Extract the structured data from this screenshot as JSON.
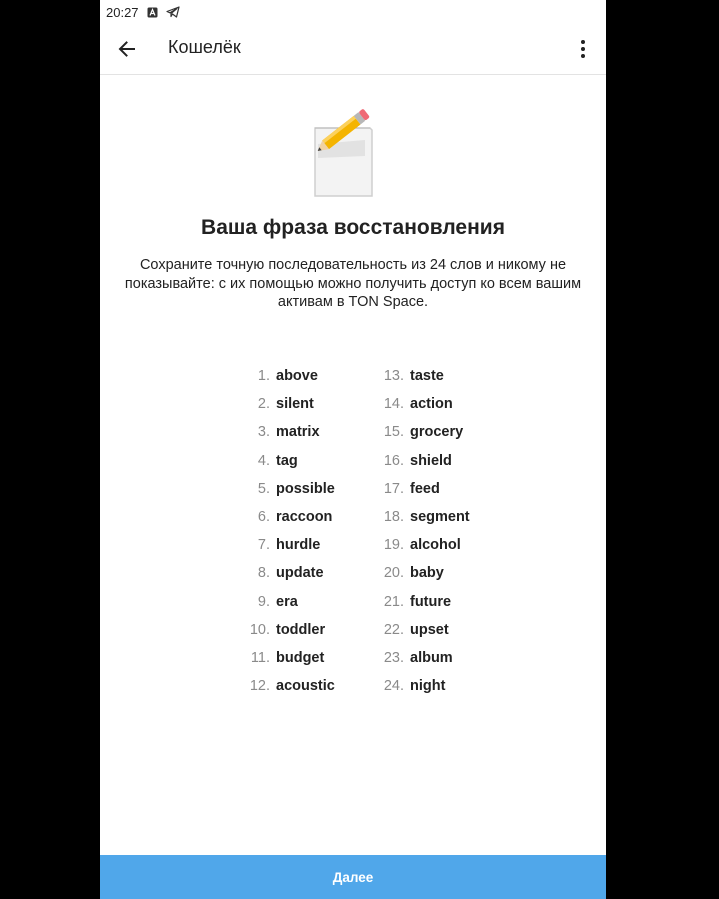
{
  "status_bar": {
    "time": "20:27",
    "icons": [
      "notification-a-icon",
      "telegram-icon"
    ]
  },
  "toolbar": {
    "title": "Кошелёк",
    "back_icon": "arrow-left-icon",
    "menu_icon": "more-vertical-icon"
  },
  "illustration": {
    "icon": "pencil-paper-icon"
  },
  "heading": "Ваша фраза восстановления",
  "description": "Сохраните точную последовательность из 24 слов и никому не показывайте: с их помощью можно получить доступ ко всем вашим активам в TON Space.",
  "words_left": [
    {
      "num": "1.",
      "word": "above"
    },
    {
      "num": "2.",
      "word": "silent"
    },
    {
      "num": "3.",
      "word": "matrix"
    },
    {
      "num": "4.",
      "word": "tag"
    },
    {
      "num": "5.",
      "word": "possible"
    },
    {
      "num": "6.",
      "word": "raccoon"
    },
    {
      "num": "7.",
      "word": "hurdle"
    },
    {
      "num": "8.",
      "word": "update"
    },
    {
      "num": "9.",
      "word": "era"
    },
    {
      "num": "10.",
      "word": "toddler"
    },
    {
      "num": "11.",
      "word": "budget"
    },
    {
      "num": "12.",
      "word": "acoustic"
    }
  ],
  "words_right": [
    {
      "num": "13.",
      "word": "taste"
    },
    {
      "num": "14.",
      "word": "action"
    },
    {
      "num": "15.",
      "word": "grocery"
    },
    {
      "num": "16.",
      "word": "shield"
    },
    {
      "num": "17.",
      "word": "feed"
    },
    {
      "num": "18.",
      "word": "segment"
    },
    {
      "num": "19.",
      "word": "alcohol"
    },
    {
      "num": "20.",
      "word": "baby"
    },
    {
      "num": "21.",
      "word": "future"
    },
    {
      "num": "22.",
      "word": "upset"
    },
    {
      "num": "23.",
      "word": "album"
    },
    {
      "num": "24.",
      "word": "night"
    }
  ],
  "next_button": {
    "label": "Далее"
  },
  "colors": {
    "accent": "#50a7ea",
    "text": "#222222",
    "number": "#8a8a8a"
  }
}
